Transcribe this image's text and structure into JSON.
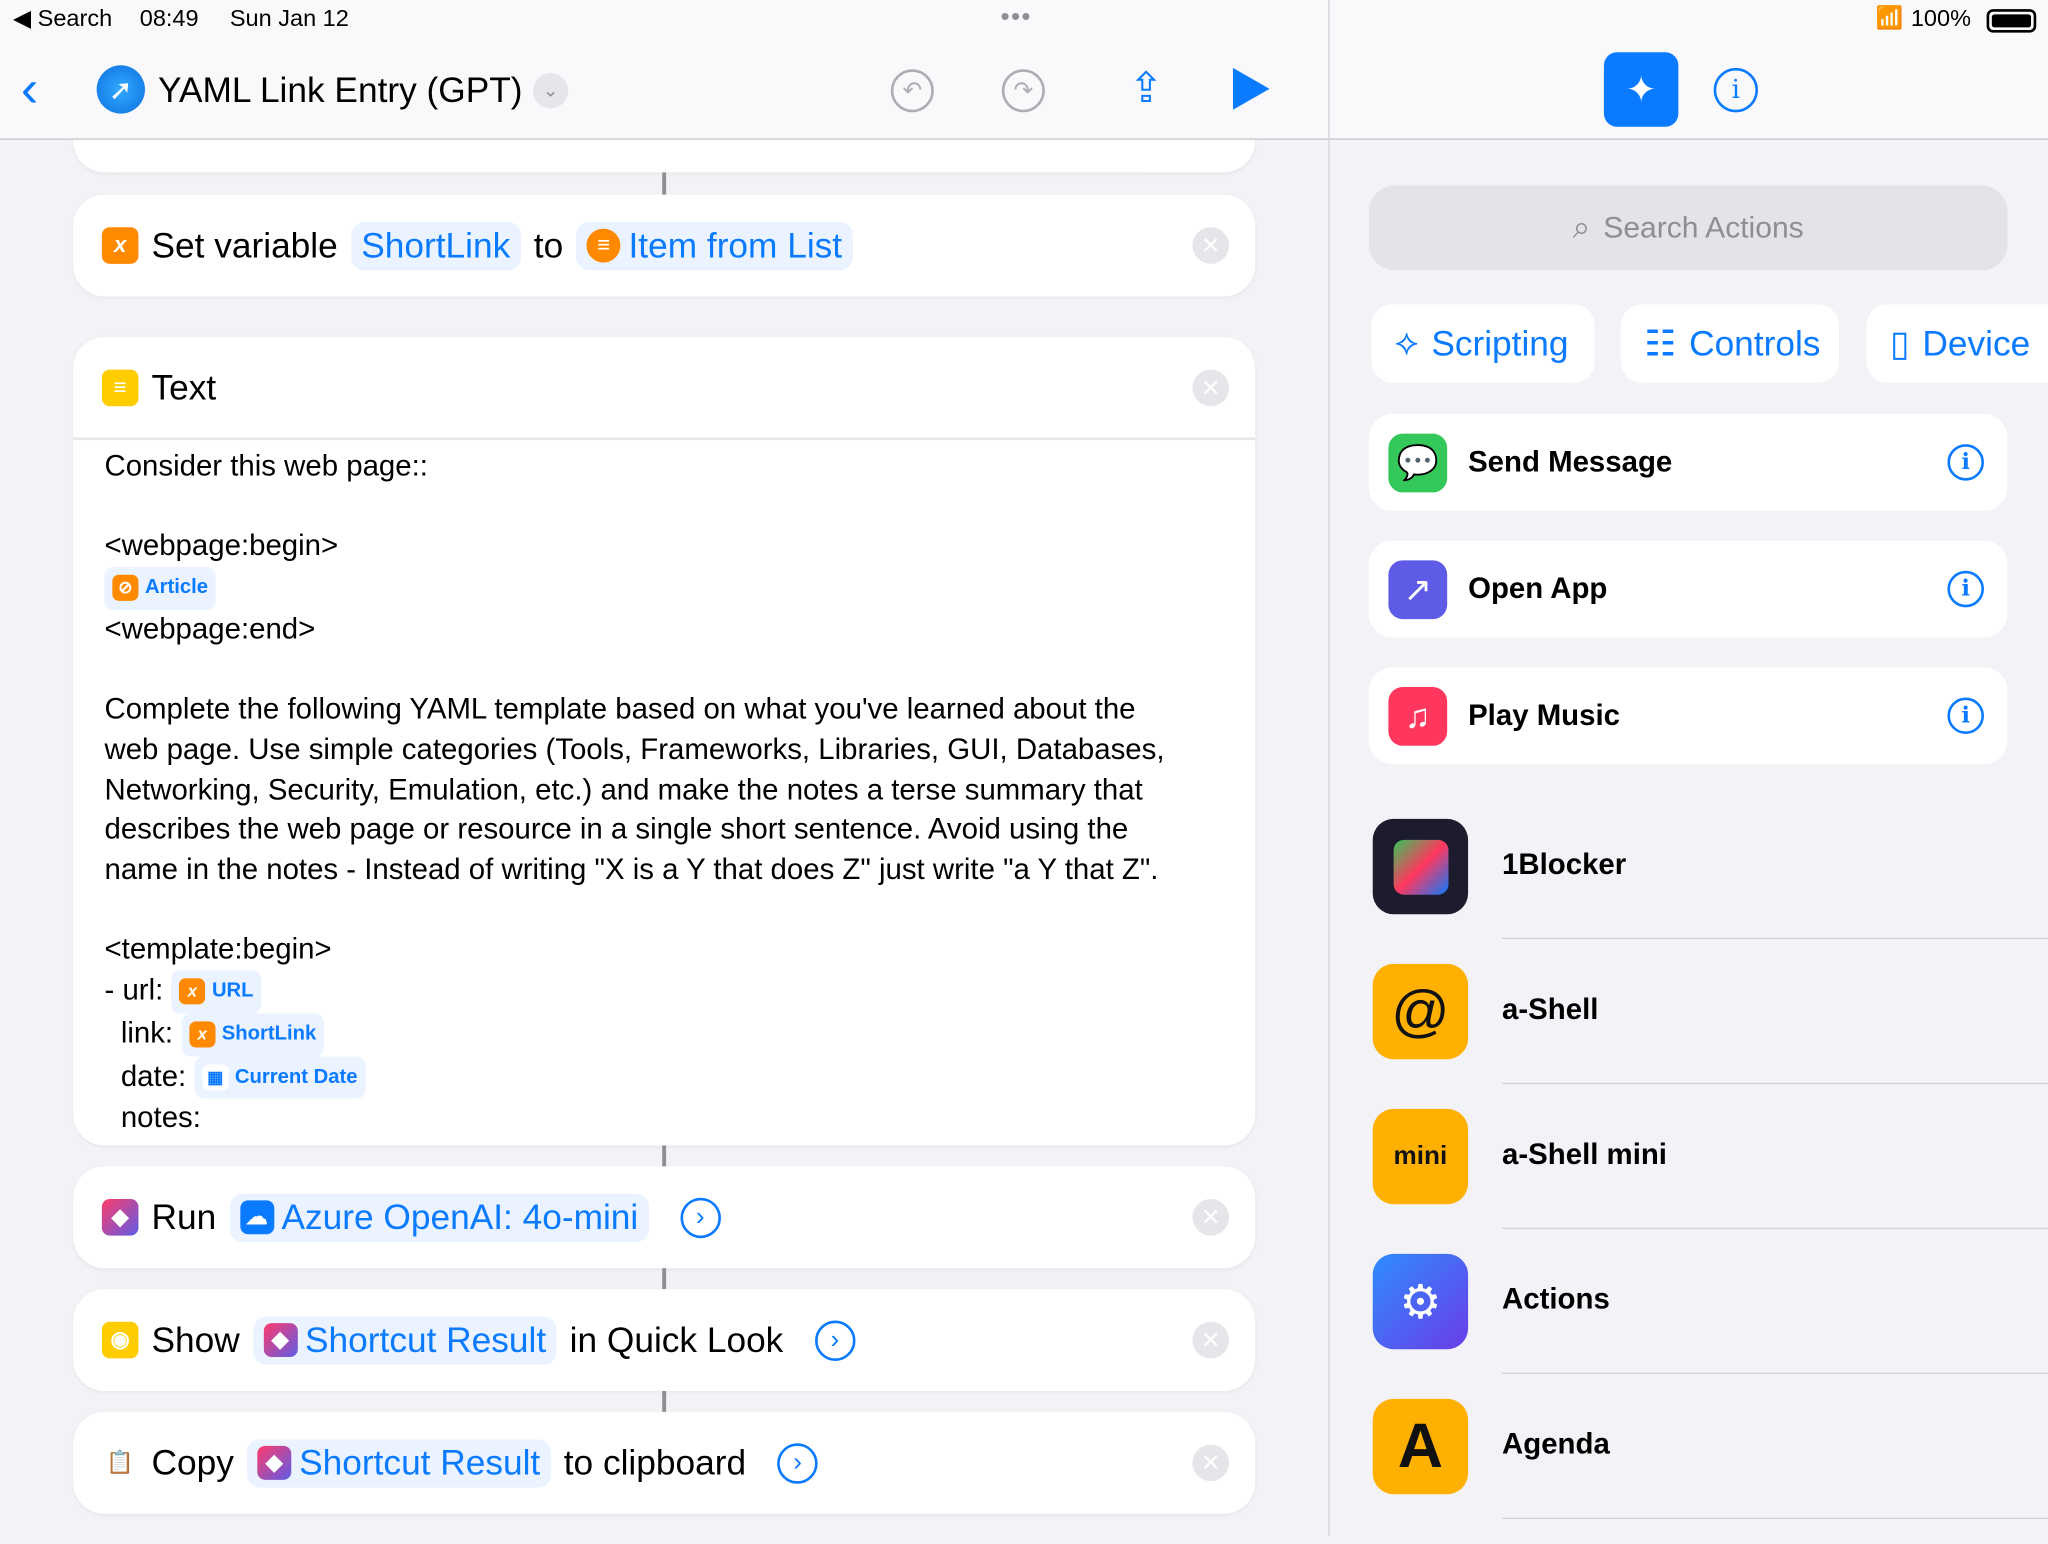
{
  "status": {
    "back_label": "Search",
    "time": "08:49",
    "date": "Sun Jan 12",
    "battery": "100%"
  },
  "header": {
    "title": "YAML Link Entry (GPT)"
  },
  "actions": {
    "set_variable": {
      "verb": "Set variable",
      "variable": "ShortLink",
      "to": "to",
      "value": "Item from List"
    },
    "text": {
      "title": "Text",
      "lines": {
        "l1": "Consider this web page::",
        "l2": "<webpage:begin>",
        "article": "Article",
        "l4": "<webpage:end>",
        "p1": "Complete the following YAML template based on what you've learned about the",
        "p2": "web page. Use simple categories (Tools, Frameworks, Libraries, GUI, Databases,",
        "p3": "Networking, Security, Emulation, etc.) and make the notes a terse summary that",
        "p4": "describes the web page or resource in a single short sentence. Avoid using the",
        "p5": "name in the notes - Instead of writing \"X is a Y that does Z\" just write \"a Y that Z\".",
        "t1": "<template:begin>",
        "t2": "- url:",
        "t2v": "URL",
        "t3": "link:",
        "t3v": "ShortLink",
        "t4": "date:",
        "t4v": "Current Date",
        "t5": "notes:"
      }
    },
    "run": {
      "verb": "Run",
      "value": "Azure OpenAI: 4o-mini"
    },
    "show": {
      "verb": "Show",
      "value": "Shortcut Result",
      "suffix": "in Quick Look"
    },
    "copy": {
      "verb": "Copy",
      "value": "Shortcut Result",
      "suffix": "to clipboard"
    }
  },
  "sidebar": {
    "search_placeholder": "Search Actions",
    "categories": [
      "Scripting",
      "Controls",
      "Device"
    ],
    "suggested": [
      {
        "label": "Send Message",
        "color": "#34c759"
      },
      {
        "label": "Open App",
        "color": "#5e5ce6"
      },
      {
        "label": "Play Music",
        "color": "#ff375f"
      }
    ],
    "apps": [
      "1Blocker",
      "a-Shell",
      "a-Shell mini",
      "Actions",
      "Agenda"
    ]
  },
  "colors": {
    "accent": "#0a7aff",
    "variable": "#ff8a00",
    "text_icon": "#ffcc00"
  }
}
